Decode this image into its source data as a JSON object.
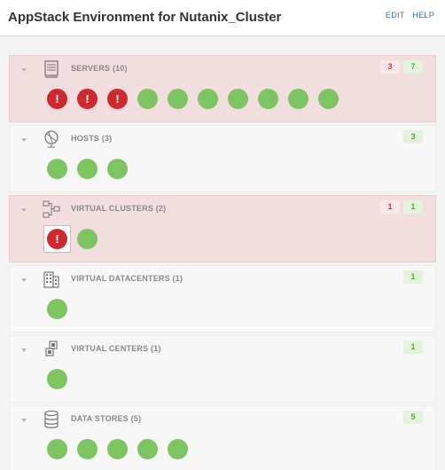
{
  "header": {
    "title": "AppStack Environment for Nutanix_Cluster",
    "edit_label": "EDIT",
    "help_label": "HELP"
  },
  "sections": [
    {
      "key": "servers",
      "label": "SERVERS (10)",
      "icon": "server-icon",
      "alert": true,
      "badges": [
        {
          "value": "3",
          "status": "error"
        },
        {
          "value": "7",
          "status": "ok"
        }
      ],
      "items": [
        "error",
        "error",
        "error",
        "ok",
        "ok",
        "ok",
        "ok",
        "ok",
        "ok",
        "ok"
      ]
    },
    {
      "key": "hosts",
      "label": "HOSTS (3)",
      "icon": "globe-icon",
      "alert": false,
      "badges": [
        {
          "value": "3",
          "status": "ok"
        }
      ],
      "items": [
        "ok",
        "ok",
        "ok"
      ]
    },
    {
      "key": "virtual-clusters",
      "label": "VIRTUAL CLUSTERS (2)",
      "icon": "cluster-icon",
      "alert": true,
      "badges": [
        {
          "value": "1",
          "status": "error"
        },
        {
          "value": "1",
          "status": "ok"
        }
      ],
      "items": [
        "error-selected",
        "ok"
      ]
    },
    {
      "key": "virtual-datacenters",
      "label": "VIRTUAL DATACENTERS (1)",
      "icon": "building-icon",
      "alert": false,
      "badges": [
        {
          "value": "1",
          "status": "ok"
        }
      ],
      "items": [
        "ok"
      ]
    },
    {
      "key": "virtual-centers",
      "label": "VIRTUAL CENTERS (1)",
      "icon": "vcenter-icon",
      "alert": false,
      "badges": [
        {
          "value": "1",
          "status": "ok"
        }
      ],
      "items": [
        "ok"
      ]
    },
    {
      "key": "data-stores",
      "label": "DATA STORES (5)",
      "icon": "database-icon",
      "alert": false,
      "badges": [
        {
          "value": "5",
          "status": "ok"
        }
      ],
      "items": [
        "ok",
        "ok",
        "ok",
        "ok",
        "ok"
      ]
    }
  ],
  "colors": {
    "ok": "#7dc560",
    "error": "#d0282f",
    "alert_bg": "#f2dede",
    "link": "#3a6fa8"
  },
  "error_glyph": "!"
}
